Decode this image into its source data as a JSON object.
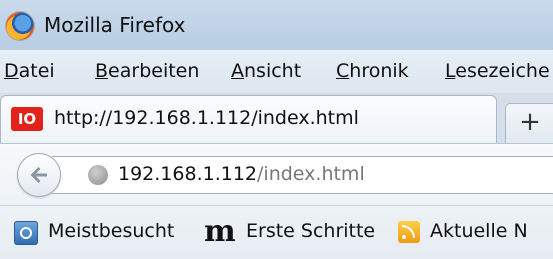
{
  "window": {
    "title": "Mozilla Firefox"
  },
  "menu": {
    "items": [
      {
        "underline": "D",
        "rest": "atei"
      },
      {
        "underline": "B",
        "rest": "earbeiten"
      },
      {
        "underline": "A",
        "rest": "nsicht"
      },
      {
        "underline": "C",
        "rest": "hronik"
      },
      {
        "underline": "L",
        "rest": "esezeiche"
      }
    ]
  },
  "tab": {
    "favicon_text": "IO",
    "title": "http://192.168.1.112/index.html",
    "new_tab_label": "+"
  },
  "navbar": {
    "url_host": "192.168.1.112",
    "url_path": "/index.html"
  },
  "bookmarks": {
    "items": [
      {
        "label": "Meistbesucht"
      },
      {
        "label": "Erste Schritte"
      },
      {
        "label": "Aktuelle N"
      }
    ],
    "erste_icon_text": "m"
  },
  "colors": {
    "titlebar": "#c9daec",
    "favicon_red": "#e2231a",
    "url_path_gray": "#777777"
  }
}
